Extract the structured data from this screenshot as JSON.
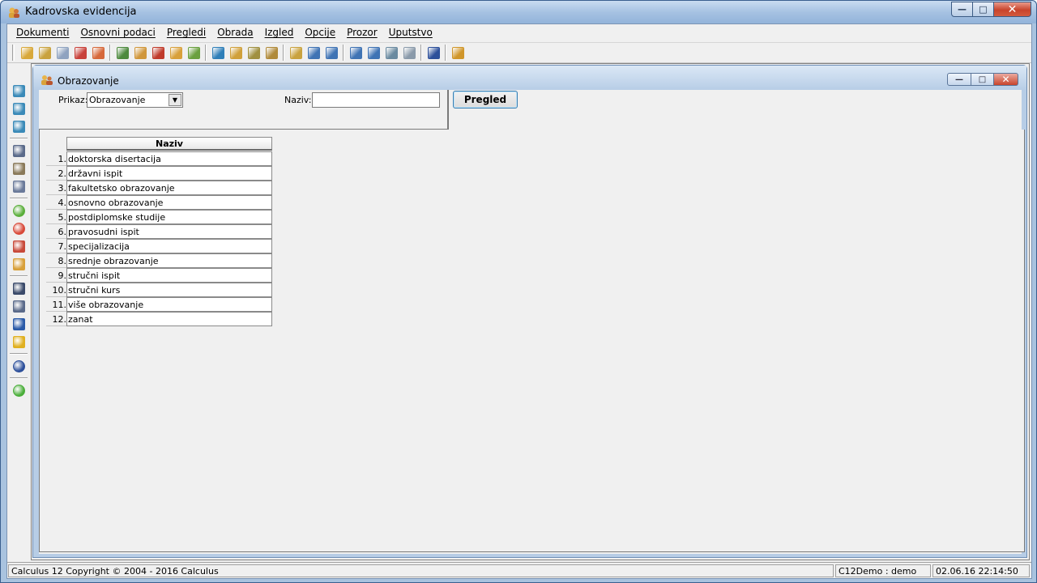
{
  "window": {
    "title": "Kadrovska evidencija"
  },
  "menu": [
    "Dokumenti",
    "Osnovni podaci",
    "Pregledi",
    "Obrada",
    "Izgled",
    "Opcije",
    "Prozor",
    "Uputstvo"
  ],
  "child": {
    "title": "Obrazovanje",
    "prikaz_label": "Prikaz:",
    "prikaz_value": "Obrazovanje",
    "naziv_label": "Naziv:",
    "naziv_value": "",
    "pregled_button": "Pregled"
  },
  "grid": {
    "header": "Naziv",
    "rows": [
      {
        "num": "1.",
        "naziv": "doktorska disertacija"
      },
      {
        "num": "2.",
        "naziv": "državni ispit"
      },
      {
        "num": "3.",
        "naziv": "fakultetsko obrazovanje"
      },
      {
        "num": "4.",
        "naziv": "osnovno obrazovanje"
      },
      {
        "num": "5.",
        "naziv": "postdiplomske studije"
      },
      {
        "num": "6.",
        "naziv": "pravosudni ispit"
      },
      {
        "num": "7.",
        "naziv": "specijalizacija"
      },
      {
        "num": "8.",
        "naziv": "srednje obrazovanje"
      },
      {
        "num": "9.",
        "naziv": "stručni ispit"
      },
      {
        "num": "10.",
        "naziv": "stručni kurs"
      },
      {
        "num": "11.",
        "naziv": "više obrazovanje"
      },
      {
        "num": "12.",
        "naziv": "zanat"
      }
    ]
  },
  "status": {
    "copyright": "Calculus 12  Copyright © 2004 - 2016  Calculus",
    "user": "C12Demo : demo",
    "datetime": "02.06.16 22:14:50"
  },
  "toolbar_icons": [
    {
      "name": "open-folder-icon",
      "color": "#d8a83a"
    },
    {
      "name": "document-edit-icon",
      "color": "#c9a23e"
    },
    {
      "name": "key-icon",
      "color": "#8fa3c0"
    },
    {
      "name": "delete-document-icon",
      "color": "#c8413a"
    },
    {
      "name": "users-delete-icon",
      "color": "#d6683a"
    },
    {
      "name": "sep"
    },
    {
      "name": "org-chart-icon",
      "color": "#4d8a3e"
    },
    {
      "name": "tools-icon",
      "color": "#d0963a"
    },
    {
      "name": "function-icon",
      "color": "#c03a2a"
    },
    {
      "name": "hierarchy-icon",
      "color": "#d8a03a"
    },
    {
      "name": "user-icon",
      "color": "#6aa03e"
    },
    {
      "name": "sep"
    },
    {
      "name": "globe-icon",
      "color": "#2f7fb8"
    },
    {
      "name": "settings-user-icon",
      "color": "#d0a03a"
    },
    {
      "name": "home-settings-icon",
      "color": "#a09040"
    },
    {
      "name": "home-icon",
      "color": "#b08a3a"
    },
    {
      "name": "sep"
    },
    {
      "name": "report-icon",
      "color": "#c9a23e"
    },
    {
      "name": "report-info-icon",
      "color": "#3f73b4"
    },
    {
      "name": "info-list-icon",
      "color": "#3f73b4"
    },
    {
      "name": "sep"
    },
    {
      "name": "layout-icon",
      "color": "#3f73b4"
    },
    {
      "name": "grid-view-icon",
      "color": "#3f73b4"
    },
    {
      "name": "network-icon",
      "color": "#6a8aa0"
    },
    {
      "name": "mail-icon",
      "color": "#8a9aaa"
    },
    {
      "name": "sep"
    },
    {
      "name": "help-icon",
      "color": "#2c4f9a"
    },
    {
      "name": "sep"
    },
    {
      "name": "exit-icon",
      "color": "#d0962a"
    }
  ],
  "sidebar_icons": [
    {
      "name": "save-icon",
      "color": "#3a8ab8"
    },
    {
      "name": "save-as-icon",
      "color": "#3a8ab8"
    },
    {
      "name": "save-all-icon",
      "color": "#3a8ab8"
    },
    {
      "name": "sep"
    },
    {
      "name": "print-icon",
      "color": "#5a6a8a"
    },
    {
      "name": "print-preview-icon",
      "color": "#8a7a5a"
    },
    {
      "name": "print-settings-icon",
      "color": "#6a7a9a"
    },
    {
      "name": "sep"
    },
    {
      "name": "add-icon",
      "color": "#5aae3a",
      "round": true
    },
    {
      "name": "remove-icon",
      "color": "#d84a3a",
      "round": true
    },
    {
      "name": "undo-icon",
      "color": "#c84a3a"
    },
    {
      "name": "edit-icon",
      "color": "#d8a03a"
    },
    {
      "name": "sep"
    },
    {
      "name": "find-icon",
      "color": "#3a4a6a"
    },
    {
      "name": "find-next-icon",
      "color": "#5a6a8a"
    },
    {
      "name": "sort-icon",
      "color": "#2a5aa8"
    },
    {
      "name": "filter-icon",
      "color": "#e0b020"
    },
    {
      "name": "sep"
    },
    {
      "name": "help-icon",
      "color": "#2c4f9a",
      "round": true
    },
    {
      "name": "sep"
    },
    {
      "name": "go-icon",
      "color": "#4aae3a",
      "round": true
    }
  ]
}
